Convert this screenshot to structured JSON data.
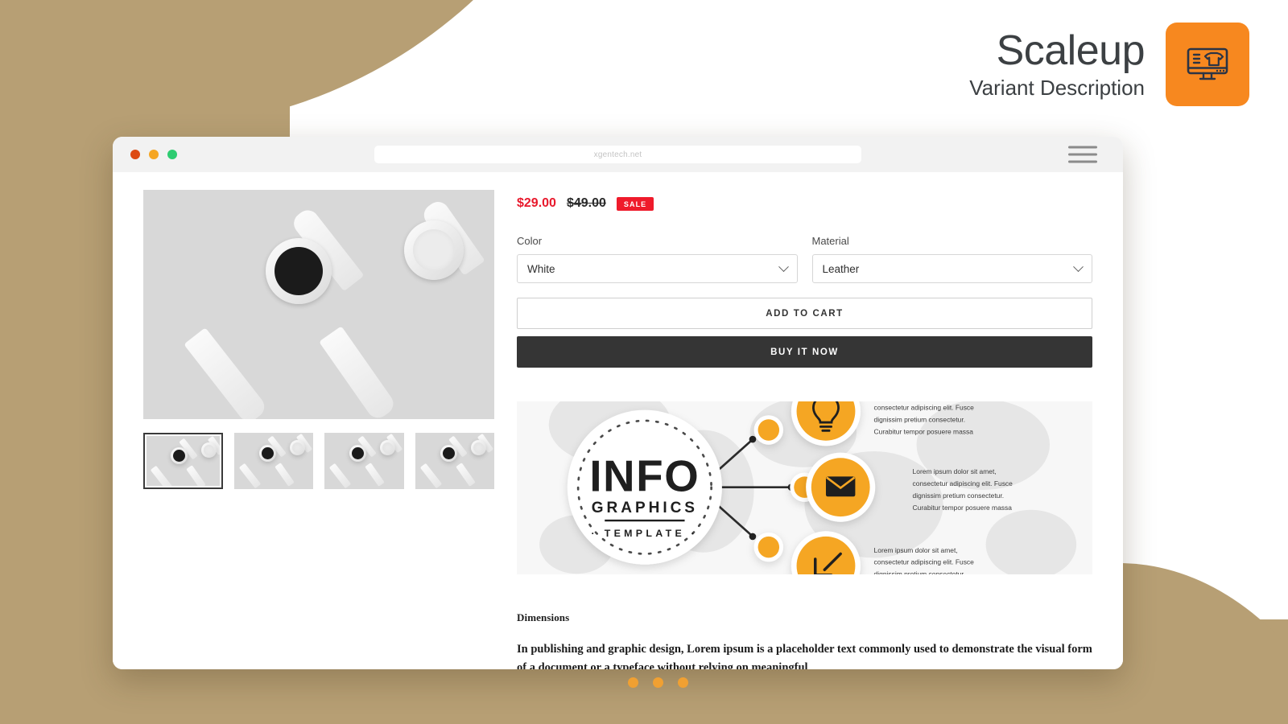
{
  "brand": {
    "title": "Scaleup",
    "subtitle": "Variant Description",
    "icon_name": "monitor-tshirt-icon",
    "accent_color": "#f7881f",
    "background_color": "#b79f74"
  },
  "browser": {
    "url": "xgentech.net",
    "traffic_lights": [
      "close",
      "minimize",
      "maximize"
    ],
    "menu_icon": "hamburger-icon"
  },
  "product": {
    "price_current": "$29.00",
    "price_compare": "$49.00",
    "sale_badge": "SALE",
    "gallery": {
      "thumbnails": [
        "thumbnail-1",
        "thumbnail-2",
        "thumbnail-3",
        "thumbnail-4"
      ],
      "selected_index": 0
    },
    "options": [
      {
        "label": "Color",
        "value": "White"
      },
      {
        "label": "Material",
        "value": "Leather"
      }
    ],
    "buttons": {
      "add_to_cart": "ADD TO CART",
      "buy_it_now": "BUY IT NOW"
    }
  },
  "infographic": {
    "center_line1": "INFO",
    "center_line2": "GRAPHICS",
    "center_line3": "TEMPLATE",
    "nodes": [
      {
        "icon": "lightbulb-icon",
        "text": "Lorem ipsum dolor sit amet, consectetur adipiscing elit. Fusce dignissim pretium consectetur. Curabitur tempor posuere massa"
      },
      {
        "icon": "envelope-icon",
        "text": "Lorem ipsum dolor sit amet, consectetur adipiscing elit. Fusce dignissim pretium consectetur. Curabitur tempor posuere massa"
      },
      {
        "icon": "arrow-down-left-icon",
        "text": "Lorem ipsum dolor sit amet, consectetur adipiscing elit. Fusce dignissim pretium consectetur. Curabitur tempor posuere massa"
      }
    ]
  },
  "description": {
    "heading": "Dimensions",
    "body": "In publishing and graphic design, Lorem ipsum is a placeholder text commonly used to demonstrate the visual form of a document or a typeface without relying on meaningful"
  },
  "carousel": {
    "dot_count": 3,
    "dot_color": "#f0a032"
  }
}
